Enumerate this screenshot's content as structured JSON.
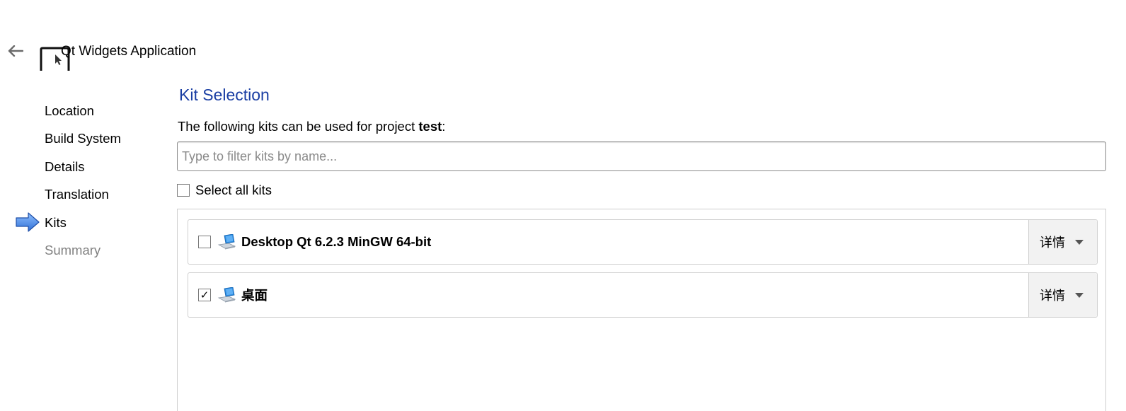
{
  "window": {
    "title": "Qt Widgets Application"
  },
  "icons": {
    "back": "arrow-left-icon",
    "app": "qt-widgets-app-icon",
    "current_step": "arrow-right-icon",
    "kit": "desktop-computer-icon",
    "dropdown": "chevron-down-icon"
  },
  "steps": [
    {
      "label": "Location",
      "state": "done"
    },
    {
      "label": "Build System",
      "state": "done"
    },
    {
      "label": "Details",
      "state": "done"
    },
    {
      "label": "Translation",
      "state": "done"
    },
    {
      "label": "Kits",
      "state": "current"
    },
    {
      "label": "Summary",
      "state": "pending"
    }
  ],
  "main": {
    "title": "Kit Selection",
    "desc_prefix": "The following kits can be used for project ",
    "project_name": "test",
    "desc_suffix": ":",
    "filter": {
      "value": "",
      "placeholder": "Type to filter kits by name..."
    },
    "select_all": {
      "label": "Select all kits",
      "checked": false
    },
    "kits": [
      {
        "name": "Desktop Qt 6.2.3 MinGW 64-bit",
        "checked": false,
        "details_label": "详情"
      },
      {
        "name": "桌面",
        "checked": true,
        "details_label": "详情"
      }
    ]
  },
  "colors": {
    "title_blue": "#1a3ea3",
    "step_arrow": "#3d7fe0",
    "dim_text": "#808080",
    "border": "#cfcfcf",
    "details_bg": "#f2f2f2"
  }
}
